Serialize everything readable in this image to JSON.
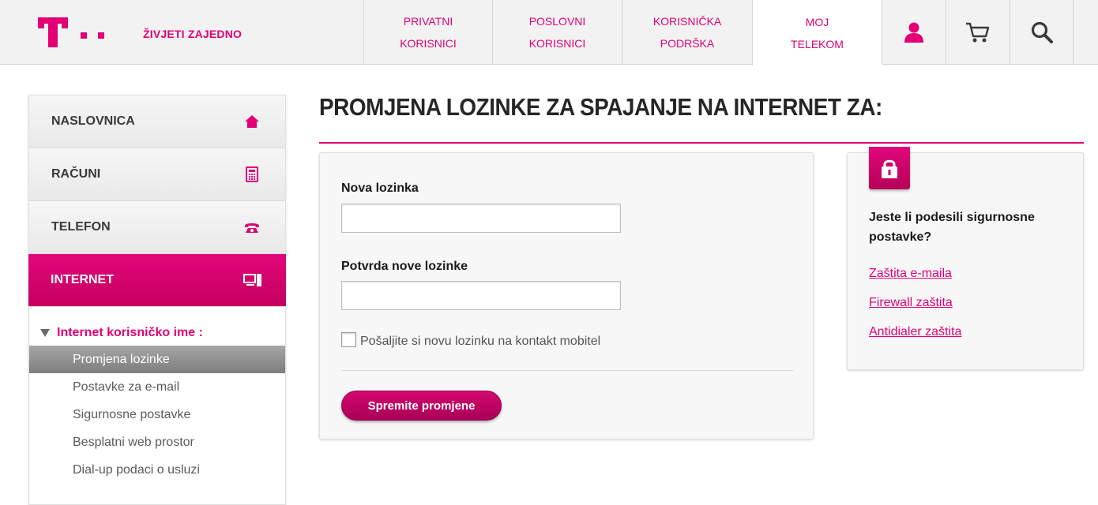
{
  "header": {
    "slogan": "ŽIVJETI ZAJEDNO",
    "nav": [
      {
        "line1": "PRIVATNI",
        "line2": "KORISNICI"
      },
      {
        "line1": "POSLOVNI",
        "line2": "KORISNICI"
      },
      {
        "line1": "KORISNIČKA",
        "line2": "PODRŠKA"
      },
      {
        "line1": "MOJ",
        "line2": "TELEKOM"
      }
    ],
    "icons": [
      "user-icon",
      "cart-icon",
      "search-icon"
    ]
  },
  "sidebar": {
    "items": [
      {
        "label": "NASLOVNICA",
        "icon": "home-icon"
      },
      {
        "label": "RAČUNI",
        "icon": "calculator-icon"
      },
      {
        "label": "TELEFON",
        "icon": "phone-icon"
      },
      {
        "label": "INTERNET",
        "icon": "computer-icon"
      }
    ],
    "sub_header": "Internet korisničko ime :",
    "sub_items": [
      "Promjena lozinke",
      "Postavke za e-mail",
      "Sigurnosne postavke",
      "Besplatni web prostor",
      "Dial-up podaci o usluzi"
    ]
  },
  "main": {
    "title": "PROMJENA LOZINKE ZA SPAJANJE NA INTERNET ZA:",
    "form": {
      "new_password_label": "Nova lozinka",
      "new_password_value": "",
      "confirm_password_label": "Potvrda nove lozinke",
      "confirm_password_value": "",
      "checkbox_label": "Pošaljite si novu lozinku na kontakt mobitel",
      "save_label": "Spremite promjene"
    },
    "security": {
      "question": "Jeste li podesili sigurnosne postavke?",
      "links": [
        "Zaštita e-maila",
        "Firewall zaštita",
        "Antidialer zaštita"
      ]
    }
  },
  "colors": {
    "brand": "#e20074",
    "text": "#262626"
  }
}
